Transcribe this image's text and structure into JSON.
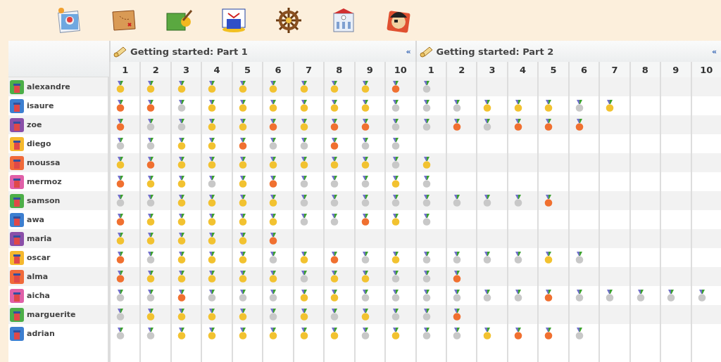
{
  "sections": [
    {
      "title": "Getting started: Part 1",
      "collapse": "«",
      "columns": [
        "1",
        "2",
        "3",
        "4",
        "5",
        "6",
        "7",
        "8",
        "9",
        "10"
      ]
    },
    {
      "title": "Getting started: Part 2",
      "collapse": "«",
      "columns": [
        "1",
        "2",
        "3",
        "4",
        "5",
        "6",
        "7",
        "8",
        "9",
        "10"
      ]
    }
  ],
  "students": [
    {
      "name": "alexandre",
      "color": "#4cae48",
      "results": [
        [
          {
            "color": "#f2c230"
          },
          {
            "color": "#f2c230"
          },
          {
            "color": "#f2c230"
          },
          {
            "color": "#f2c230"
          },
          {
            "color": "#f2c230"
          },
          {
            "color": "#f2c230"
          },
          {
            "color": "#f2c230"
          },
          {
            "color": "#f2c230"
          },
          {
            "color": "#f2c230"
          },
          {
            "color": "#f07030"
          }
        ],
        [
          {
            "color": "#c8c8c8"
          }
        ]
      ]
    },
    {
      "name": "isaure",
      "color": "#3d7fd0",
      "results": [
        [
          {
            "color": "#f07030"
          },
          {
            "color": "#f07030"
          },
          {
            "color": "#c8c8c8"
          },
          {
            "color": "#f2c230"
          },
          {
            "color": "#f2c230"
          },
          {
            "color": "#f2c230"
          },
          {
            "color": "#f2c230"
          },
          {
            "color": "#f2c230"
          },
          {
            "color": "#f2c230"
          },
          {
            "color": "#c8c8c8"
          }
        ],
        [
          {
            "color": "#c8c8c8"
          },
          {
            "color": "#c8c8c8"
          },
          {
            "color": "#f2c230"
          },
          {
            "color": "#f2c230"
          },
          {
            "color": "#f2c230"
          },
          {
            "color": "#c8c8c8"
          },
          {
            "color": "#f2c230"
          }
        ]
      ]
    },
    {
      "name": "zoe",
      "color": "#8a4fa8",
      "results": [
        [
          {
            "color": "#f07030"
          },
          {
            "color": "#c8c8c8"
          },
          {
            "color": "#c8c8c8"
          },
          {
            "color": "#f2c230"
          },
          {
            "color": "#f2c230"
          },
          {
            "color": "#f07030"
          },
          {
            "color": "#f2c230"
          },
          {
            "color": "#f07030"
          },
          {
            "color": "#f07030"
          },
          {
            "color": "#c8c8c8"
          }
        ],
        [
          {
            "color": "#c8c8c8"
          },
          {
            "color": "#f07030"
          },
          {
            "color": "#c8c8c8"
          },
          {
            "color": "#f07030"
          },
          {
            "color": "#f07030"
          },
          {
            "color": "#f07030"
          }
        ]
      ]
    },
    {
      "name": "diego",
      "color": "#f5b82e",
      "results": [
        [
          {
            "color": "#c8c8c8"
          },
          {
            "color": "#c8c8c8"
          },
          {
            "color": "#f2c230"
          },
          {
            "color": "#f2c230"
          },
          {
            "color": "#f07030"
          },
          {
            "color": "#c8c8c8"
          },
          {
            "color": "#c8c8c8"
          },
          {
            "color": "#f07030"
          },
          {
            "color": "#c8c8c8"
          },
          {
            "color": "#c8c8c8"
          }
        ]
      ]
    },
    {
      "name": "moussa",
      "color": "#f06a3a",
      "results": [
        [
          {
            "color": "#f2c230"
          },
          {
            "color": "#f07030"
          },
          {
            "color": "#f2c230"
          },
          {
            "color": "#f2c230"
          },
          {
            "color": "#f2c230"
          },
          {
            "color": "#f2c230"
          },
          {
            "color": "#f2c230"
          },
          {
            "color": "#f2c230"
          },
          {
            "color": "#f2c230"
          },
          {
            "color": "#c8c8c8"
          }
        ],
        [
          {
            "color": "#f2c230"
          }
        ]
      ]
    },
    {
      "name": "mermoz",
      "color": "#e060a8",
      "results": [
        [
          {
            "color": "#f07030"
          },
          {
            "color": "#f2c230"
          },
          {
            "color": "#f2c230"
          },
          {
            "color": "#c8c8c8"
          },
          {
            "color": "#f2c230"
          },
          {
            "color": "#f07030"
          },
          {
            "color": "#c8c8c8"
          },
          {
            "color": "#c8c8c8"
          },
          {
            "color": "#c8c8c8"
          },
          {
            "color": "#f2c230"
          }
        ],
        [
          {
            "color": "#c8c8c8"
          }
        ]
      ]
    },
    {
      "name": "samson",
      "color": "#4cae48",
      "results": [
        [
          {
            "color": "#c8c8c8"
          },
          {
            "color": "#c8c8c8"
          },
          {
            "color": "#f2c230"
          },
          {
            "color": "#f2c230"
          },
          {
            "color": "#f2c230"
          },
          {
            "color": "#f2c230"
          },
          {
            "color": "#c8c8c8"
          },
          {
            "color": "#c8c8c8"
          },
          {
            "color": "#c8c8c8"
          },
          {
            "color": "#c8c8c8"
          }
        ],
        [
          {
            "color": "#c8c8c8"
          },
          {
            "color": "#c8c8c8"
          },
          {
            "color": "#c8c8c8"
          },
          {
            "color": "#c8c8c8"
          },
          {
            "color": "#f07030"
          }
        ]
      ]
    },
    {
      "name": "awa",
      "color": "#3d7fd0",
      "results": [
        [
          {
            "color": "#f07030"
          },
          {
            "color": "#f2c230"
          },
          {
            "color": "#f2c230"
          },
          {
            "color": "#f2c230"
          },
          {
            "color": "#f2c230"
          },
          {
            "color": "#f2c230"
          },
          {
            "color": "#c8c8c8"
          },
          {
            "color": "#c8c8c8"
          },
          {
            "color": "#f07030"
          },
          {
            "color": "#f2c230"
          }
        ],
        [
          {
            "color": "#c8c8c8"
          }
        ]
      ]
    },
    {
      "name": "maria",
      "color": "#8a4fa8",
      "results": [
        [
          {
            "color": "#f2c230"
          },
          {
            "color": "#f2c230"
          },
          {
            "color": "#f2c230"
          },
          {
            "color": "#f2c230"
          },
          {
            "color": "#f2c230"
          },
          {
            "color": "#f07030"
          }
        ]
      ]
    },
    {
      "name": "oscar",
      "color": "#f5b82e",
      "results": [
        [
          {
            "color": "#f07030"
          },
          {
            "color": "#c8c8c8"
          },
          {
            "color": "#f2c230"
          },
          {
            "color": "#f2c230"
          },
          {
            "color": "#f2c230"
          },
          {
            "color": "#c8c8c8"
          },
          {
            "color": "#f2c230"
          },
          {
            "color": "#f07030"
          },
          {
            "color": "#c8c8c8"
          },
          {
            "color": "#f2c230"
          }
        ],
        [
          {
            "color": "#c8c8c8"
          },
          {
            "color": "#c8c8c8"
          },
          {
            "color": "#c8c8c8"
          },
          {
            "color": "#c8c8c8"
          },
          {
            "color": "#f2c230"
          },
          {
            "color": "#c8c8c8"
          }
        ]
      ]
    },
    {
      "name": "alma",
      "color": "#f06a3a",
      "results": [
        [
          {
            "color": "#f07030"
          },
          {
            "color": "#f2c230"
          },
          {
            "color": "#f2c230"
          },
          {
            "color": "#f2c230"
          },
          {
            "color": "#f2c230"
          },
          {
            "color": "#f2c230"
          },
          {
            "color": "#c8c8c8"
          },
          {
            "color": "#f2c230"
          },
          {
            "color": "#f2c230"
          },
          {
            "color": "#c8c8c8"
          }
        ],
        [
          {
            "color": "#c8c8c8"
          },
          {
            "color": "#f07030"
          }
        ]
      ]
    },
    {
      "name": "aicha",
      "color": "#e060a8",
      "results": [
        [
          {
            "color": "#c8c8c8"
          },
          {
            "color": "#c8c8c8"
          },
          {
            "color": "#f07030"
          },
          {
            "color": "#c8c8c8"
          },
          {
            "color": "#c8c8c8"
          },
          {
            "color": "#c8c8c8"
          },
          {
            "color": "#f2c230"
          },
          {
            "color": "#f2c230"
          },
          {
            "color": "#c8c8c8"
          },
          {
            "color": "#c8c8c8"
          }
        ],
        [
          {
            "color": "#c8c8c8"
          },
          {
            "color": "#c8c8c8"
          },
          {
            "color": "#c8c8c8"
          },
          {
            "color": "#c8c8c8"
          },
          {
            "color": "#f07030"
          },
          {
            "color": "#c8c8c8"
          },
          {
            "color": "#c8c8c8"
          },
          {
            "color": "#c8c8c8"
          },
          {
            "color": "#c8c8c8"
          },
          {
            "color": "#c8c8c8"
          }
        ]
      ]
    },
    {
      "name": "marguerite",
      "color": "#4cae48",
      "results": [
        [
          {
            "color": "#c8c8c8"
          },
          {
            "color": "#f2c230"
          },
          {
            "color": "#f2c230"
          },
          {
            "color": "#f2c230"
          },
          {
            "color": "#f2c230"
          },
          {
            "color": "#c8c8c8"
          },
          {
            "color": "#f2c230"
          },
          {
            "color": "#c8c8c8"
          },
          {
            "color": "#f2c230"
          },
          {
            "color": "#c8c8c8"
          }
        ],
        [
          {
            "color": "#c8c8c8"
          },
          {
            "color": "#f07030"
          }
        ]
      ]
    },
    {
      "name": "adrian",
      "color": "#3d7fd0",
      "results": [
        [
          {
            "color": "#c8c8c8"
          },
          {
            "color": "#c8c8c8"
          },
          {
            "color": "#f2c230"
          },
          {
            "color": "#f2c230"
          },
          {
            "color": "#f2c230"
          },
          {
            "color": "#f2c230"
          },
          {
            "color": "#f2c230"
          },
          {
            "color": "#f2c230"
          },
          {
            "color": "#c8c8c8"
          },
          {
            "color": "#f2c230"
          }
        ],
        [
          {
            "color": "#c8c8c8"
          },
          {
            "color": "#c8c8c8"
          },
          {
            "color": "#f2c230"
          },
          {
            "color": "#f07030"
          },
          {
            "color": "#f07030"
          },
          {
            "color": "#c8c8c8"
          }
        ]
      ]
    }
  ]
}
